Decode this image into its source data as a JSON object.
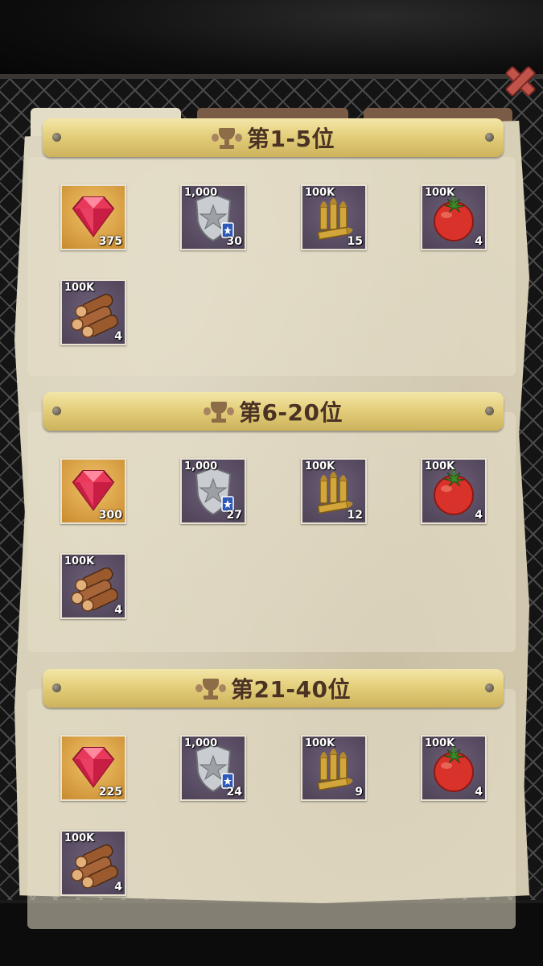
{
  "screen": {
    "close_icon": "close-icon"
  },
  "tabs": [
    {
      "label": ""
    },
    {
      "label": ""
    },
    {
      "label": ""
    }
  ],
  "sections": [
    {
      "title": "第1-5位",
      "items": [
        {
          "icon": "ruby-gem-icon",
          "top": "",
          "count": "375"
        },
        {
          "icon": "police-badge-icon",
          "top": "1,000",
          "count": "30"
        },
        {
          "icon": "bullets-icon",
          "top": "100K",
          "count": "15"
        },
        {
          "icon": "tomato-icon",
          "top": "100K",
          "count": "4"
        },
        {
          "icon": "wood-logs-icon",
          "top": "100K",
          "count": "4"
        }
      ]
    },
    {
      "title": "第6-20位",
      "items": [
        {
          "icon": "ruby-gem-icon",
          "top": "",
          "count": "300"
        },
        {
          "icon": "police-badge-icon",
          "top": "1,000",
          "count": "27"
        },
        {
          "icon": "bullets-icon",
          "top": "100K",
          "count": "12"
        },
        {
          "icon": "tomato-icon",
          "top": "100K",
          "count": "4"
        },
        {
          "icon": "wood-logs-icon",
          "top": "100K",
          "count": "4"
        }
      ]
    },
    {
      "title": "第21-40位",
      "items": [
        {
          "icon": "ruby-gem-icon",
          "top": "",
          "count": "225"
        },
        {
          "icon": "police-badge-icon",
          "top": "1,000",
          "count": "24"
        },
        {
          "icon": "bullets-icon",
          "top": "100K",
          "count": "9"
        },
        {
          "icon": "tomato-icon",
          "top": "100K",
          "count": "4"
        },
        {
          "icon": "wood-logs-icon",
          "top": "100K",
          "count": "4"
        }
      ]
    }
  ],
  "colors": {
    "banner_gold": "#e4cf7c",
    "paper": "#d7cfb6",
    "tab_active": "#e3ddc7",
    "tab_inactive": "#7a5b46",
    "close_red": "#c0534a"
  }
}
